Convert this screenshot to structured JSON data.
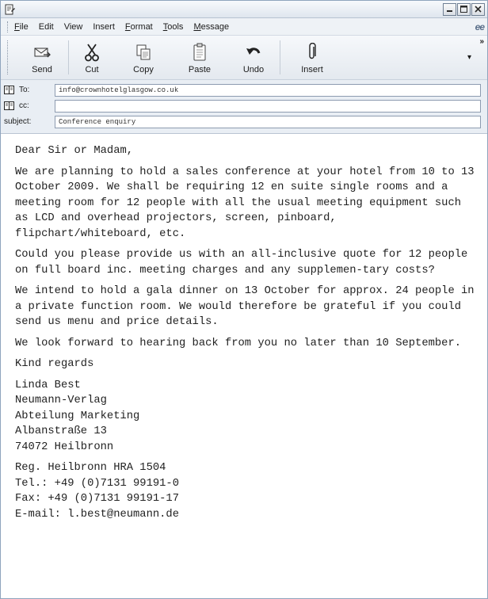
{
  "window": {
    "icons": {
      "app": "compose-mail-icon",
      "minimize": "minimize-icon",
      "maximize": "maximize-icon",
      "close": "close-icon"
    }
  },
  "menu": {
    "items": [
      {
        "mnemonic": "F",
        "rest": "ile"
      },
      {
        "mnemonic": "",
        "rest": "Edit"
      },
      {
        "mnemonic": "",
        "rest": "View"
      },
      {
        "mnemonic": "",
        "rest": "Insert"
      },
      {
        "mnemonic": "F",
        "rest": "ormat"
      },
      {
        "mnemonic": "T",
        "rest": "ools"
      },
      {
        "mnemonic": "M",
        "rest": "essage"
      }
    ],
    "logo": "ee"
  },
  "toolbar": {
    "send": "Send",
    "cut": "Cut",
    "copy": "Copy",
    "paste": "Paste",
    "undo": "Undo",
    "insert": "Insert",
    "more": "▾",
    "overflow": "»"
  },
  "headers": {
    "to_label": "To:",
    "to_value": "info@crownhotelglasgow.co.uk",
    "cc_label": "cc:",
    "cc_value": "",
    "subject_label": "subject:",
    "subject_value": "Conference enquiry"
  },
  "message": {
    "greeting": "Dear Sir or Madam,",
    "p1": "We are planning to hold a sales conference at your hotel from 10 to 13 October 2009. We shall be requiring 12 en suite single rooms and a meeting room for 12 people with all the usual meeting equipment such as LCD and overhead projectors, screen, pinboard, flipchart/whiteboard, etc.",
    "p2": "Could you please provide us with an all-inclusive quote for 12 people on full board inc. meeting charges and any supplemen-tary costs?",
    "p3": "We intend to hold a gala dinner on 13 October for approx. 24 people in a private function room. We would therefore be grateful if you could send us menu and price details.",
    "p4": "We look forward to hearing back from you no later than 10 September.",
    "closing": "Kind regards",
    "signature": [
      "Linda Best",
      "Neumann-Verlag",
      "Abteilung Marketing",
      "Albanstraße 13",
      "74072 Heilbronn"
    ],
    "contact": [
      "Reg. Heilbronn HRA 1504",
      "Tel.: +49 (0)7131 99191-0",
      "Fax: +49 (0)7131 99191-17",
      "E-mail: l.best@neumann.de"
    ]
  }
}
